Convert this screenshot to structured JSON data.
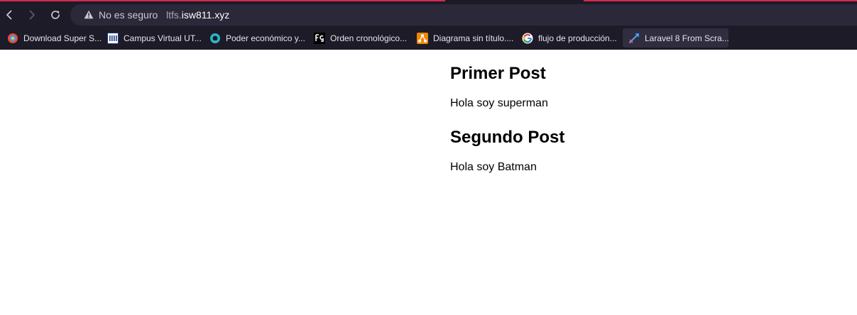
{
  "browser": {
    "security_label": "No es seguro",
    "url_prefix": "ltfs.",
    "url_domain": "isw811.xyz",
    "icons": {
      "back": "back-arrow-icon",
      "forward": "forward-arrow-icon",
      "reload": "reload-icon",
      "warning": "warning-triangle-icon"
    }
  },
  "bookmarks": [
    {
      "label": "Download Super S...",
      "icon": "supersonic-icon"
    },
    {
      "label": "Campus Virtual UT...",
      "icon": "utn-icon"
    },
    {
      "label": "Poder económico y...",
      "icon": "globe-icon"
    },
    {
      "label": "Orden cronológico...",
      "icon": "fg-icon"
    },
    {
      "label": "Diagrama sin título....",
      "icon": "drawio-icon"
    },
    {
      "label": "flujo de producción...",
      "icon": "google-icon"
    },
    {
      "label": "Laravel 8 From Scra...",
      "icon": "laracasts-icon"
    }
  ],
  "posts": [
    {
      "title": "Primer Post",
      "body": "Hola soy superman"
    },
    {
      "title": "Segundo Post",
      "body": "Hola soy Batman"
    }
  ],
  "colors": {
    "chrome_bg": "#1c1b27",
    "omnibox_bg": "#2b2939",
    "accent": "#d6284f",
    "page_bg": "#ffffff"
  }
}
